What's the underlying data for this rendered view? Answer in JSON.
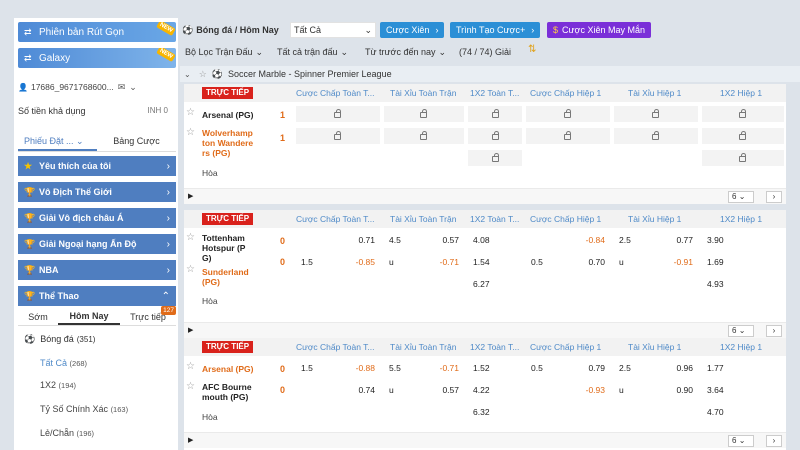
{
  "sidebar": {
    "mobile_version": "Phiên bản Rút Gọn",
    "galaxy": "Galaxy",
    "new_tag": "NEW",
    "account_id": "17686_9671768600...",
    "balance_label": "Số tiền khả dụng",
    "balance_value": "INH 0",
    "tabs": [
      "Phiếu Đặt ...",
      "Bảng Cược"
    ],
    "categories": [
      {
        "label": "Yêu thích của tôi",
        "icon": "star-icon"
      },
      {
        "label": "Vô Địch Thế Giới",
        "icon": "trophy-icon"
      },
      {
        "label": "Giải Vô địch châu Á",
        "icon": "trophy-icon"
      },
      {
        "label": "Giải Ngoại hạng Ấn Độ",
        "icon": "trophy-icon"
      },
      {
        "label": "NBA",
        "icon": "trophy-icon"
      }
    ],
    "sports_header": "Thể Thao",
    "time_tabs": [
      "Sớm",
      "Hôm Nay",
      "Trực tiếp"
    ],
    "live_badge": "127",
    "sport_name": "Bóng đá",
    "sport_count": "(351)",
    "bet_types": [
      {
        "label": "Tất Cả",
        "count": "(268)"
      },
      {
        "label": "1X2",
        "count": "(194)"
      },
      {
        "label": "Tỷ Số Chính Xác",
        "count": "(163)"
      },
      {
        "label": "Lẻ/Chẵn",
        "count": "(196)"
      }
    ]
  },
  "topbar": {
    "breadcrumb": "Bóng đá / Hôm Nay",
    "select_value": "Tất Cả",
    "btn_parlay": "Cược Xiên",
    "btn_create_bet": "Trình Tạo Cược+",
    "btn_lucky_parlay": "Cược Xiên May Mắn"
  },
  "filters": {
    "match_filter": "Bộ Lọc Trận Đấu",
    "all_matches": "Tất cả trận đấu",
    "sort": "Từ trước đến nay",
    "league_count": "(74 / 74) Giải"
  },
  "league": {
    "name": "Soccer Marble - Spinner Premier League"
  },
  "columns": [
    "Cược Chấp Toàn T...",
    "Tài Xỉu Toàn Trận",
    "1X2 Toàn T...",
    "Cược Chấp Hiệp 1",
    "Tài Xỉu Hiệp 1",
    "1X2 Hiệp 1"
  ],
  "live_label": "TRỰC TIẾP",
  "draw_label": "Hòa",
  "pager_value": "6",
  "matches": [
    {
      "home": "Arsenal (PG)",
      "away": "Wolverhampton Wanderers (PG)",
      "home_lines": [
        "Arsenal (PG)"
      ],
      "away_lines": [
        "Wolverhamp",
        "ton Wandere",
        "rs (PG)"
      ],
      "home_score": "1",
      "away_score": "1",
      "locked": true
    },
    {
      "home": "Tottenham Hotspur (PG)",
      "away": "Sunderland (PG)",
      "home_lines": [
        "Tottenham",
        "Hotspur (P",
        "G)"
      ],
      "away_lines": [
        "Sunderland",
        "(PG)"
      ],
      "home_score": "0",
      "away_score": "0",
      "odds": {
        "hdp_ft": {
          "home": [
            "",
            "0.71"
          ],
          "away": [
            "1.5",
            "-0.85"
          ]
        },
        "ou_ft": {
          "home": [
            "4.5",
            "0.57"
          ],
          "away": [
            "u",
            "-0.71"
          ]
        },
        "x12_ft": [
          "4.08",
          "1.54",
          "6.27"
        ],
        "hdp_h1": {
          "home": [
            "",
            "-0.84"
          ],
          "away": [
            "0.5",
            "0.70"
          ]
        },
        "ou_h1": {
          "home": [
            "2.5",
            "0.77"
          ],
          "away": [
            "u",
            "-0.91"
          ]
        },
        "x12_h1": [
          "3.90",
          "1.69",
          "4.93"
        ]
      }
    },
    {
      "home": "Arsenal (PG)",
      "away": "AFC Bournemouth (PG)",
      "home_lines": [
        "Arsenal (PG)"
      ],
      "away_lines": [
        "AFC Bourne",
        "mouth (PG)"
      ],
      "home_score": "0",
      "away_score": "0",
      "odds": {
        "hdp_ft": {
          "home": [
            "1.5",
            "-0.88"
          ],
          "away": [
            "",
            "0.74"
          ]
        },
        "ou_ft": {
          "home": [
            "5.5",
            "-0.71"
          ],
          "away": [
            "u",
            "0.57"
          ]
        },
        "x12_ft": [
          "1.52",
          "4.22",
          "6.32"
        ],
        "hdp_h1": {
          "home": [
            "0.5",
            "0.79"
          ],
          "away": [
            "",
            "-0.93"
          ]
        },
        "ou_h1": {
          "home": [
            "2.5",
            "0.96"
          ],
          "away": [
            "u",
            "0.90"
          ]
        },
        "x12_h1": [
          "1.77",
          "3.64",
          "4.70"
        ]
      }
    }
  ],
  "colors": {
    "accent_blue": "#4f7ec0",
    "live_red": "#d9221c",
    "orange": "#e06b19",
    "parlay_btn": "#2b8fd6",
    "lucky_btn": "#7a2fd8"
  }
}
